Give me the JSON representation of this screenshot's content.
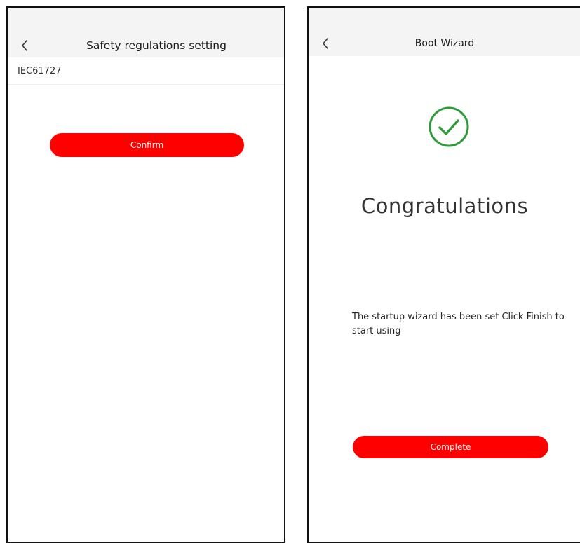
{
  "left_screen": {
    "header": {
      "title": "Safety regulations setting",
      "back_icon": "chevron-left-icon"
    },
    "list": [
      {
        "label": "IEC61727"
      }
    ],
    "confirm_label": "Confirm"
  },
  "right_screen": {
    "header": {
      "title": "Boot Wizard",
      "back_icon": "chevron-left-icon"
    },
    "success_icon": "check-circle-icon",
    "headline": "Congratulations",
    "description": "The startup wizard has been set Click Finish to start using",
    "complete_label": "Complete"
  },
  "colors": {
    "accent": "#ff0000",
    "success": "#2e9a3a",
    "header_bg": "#f4f4f4"
  }
}
